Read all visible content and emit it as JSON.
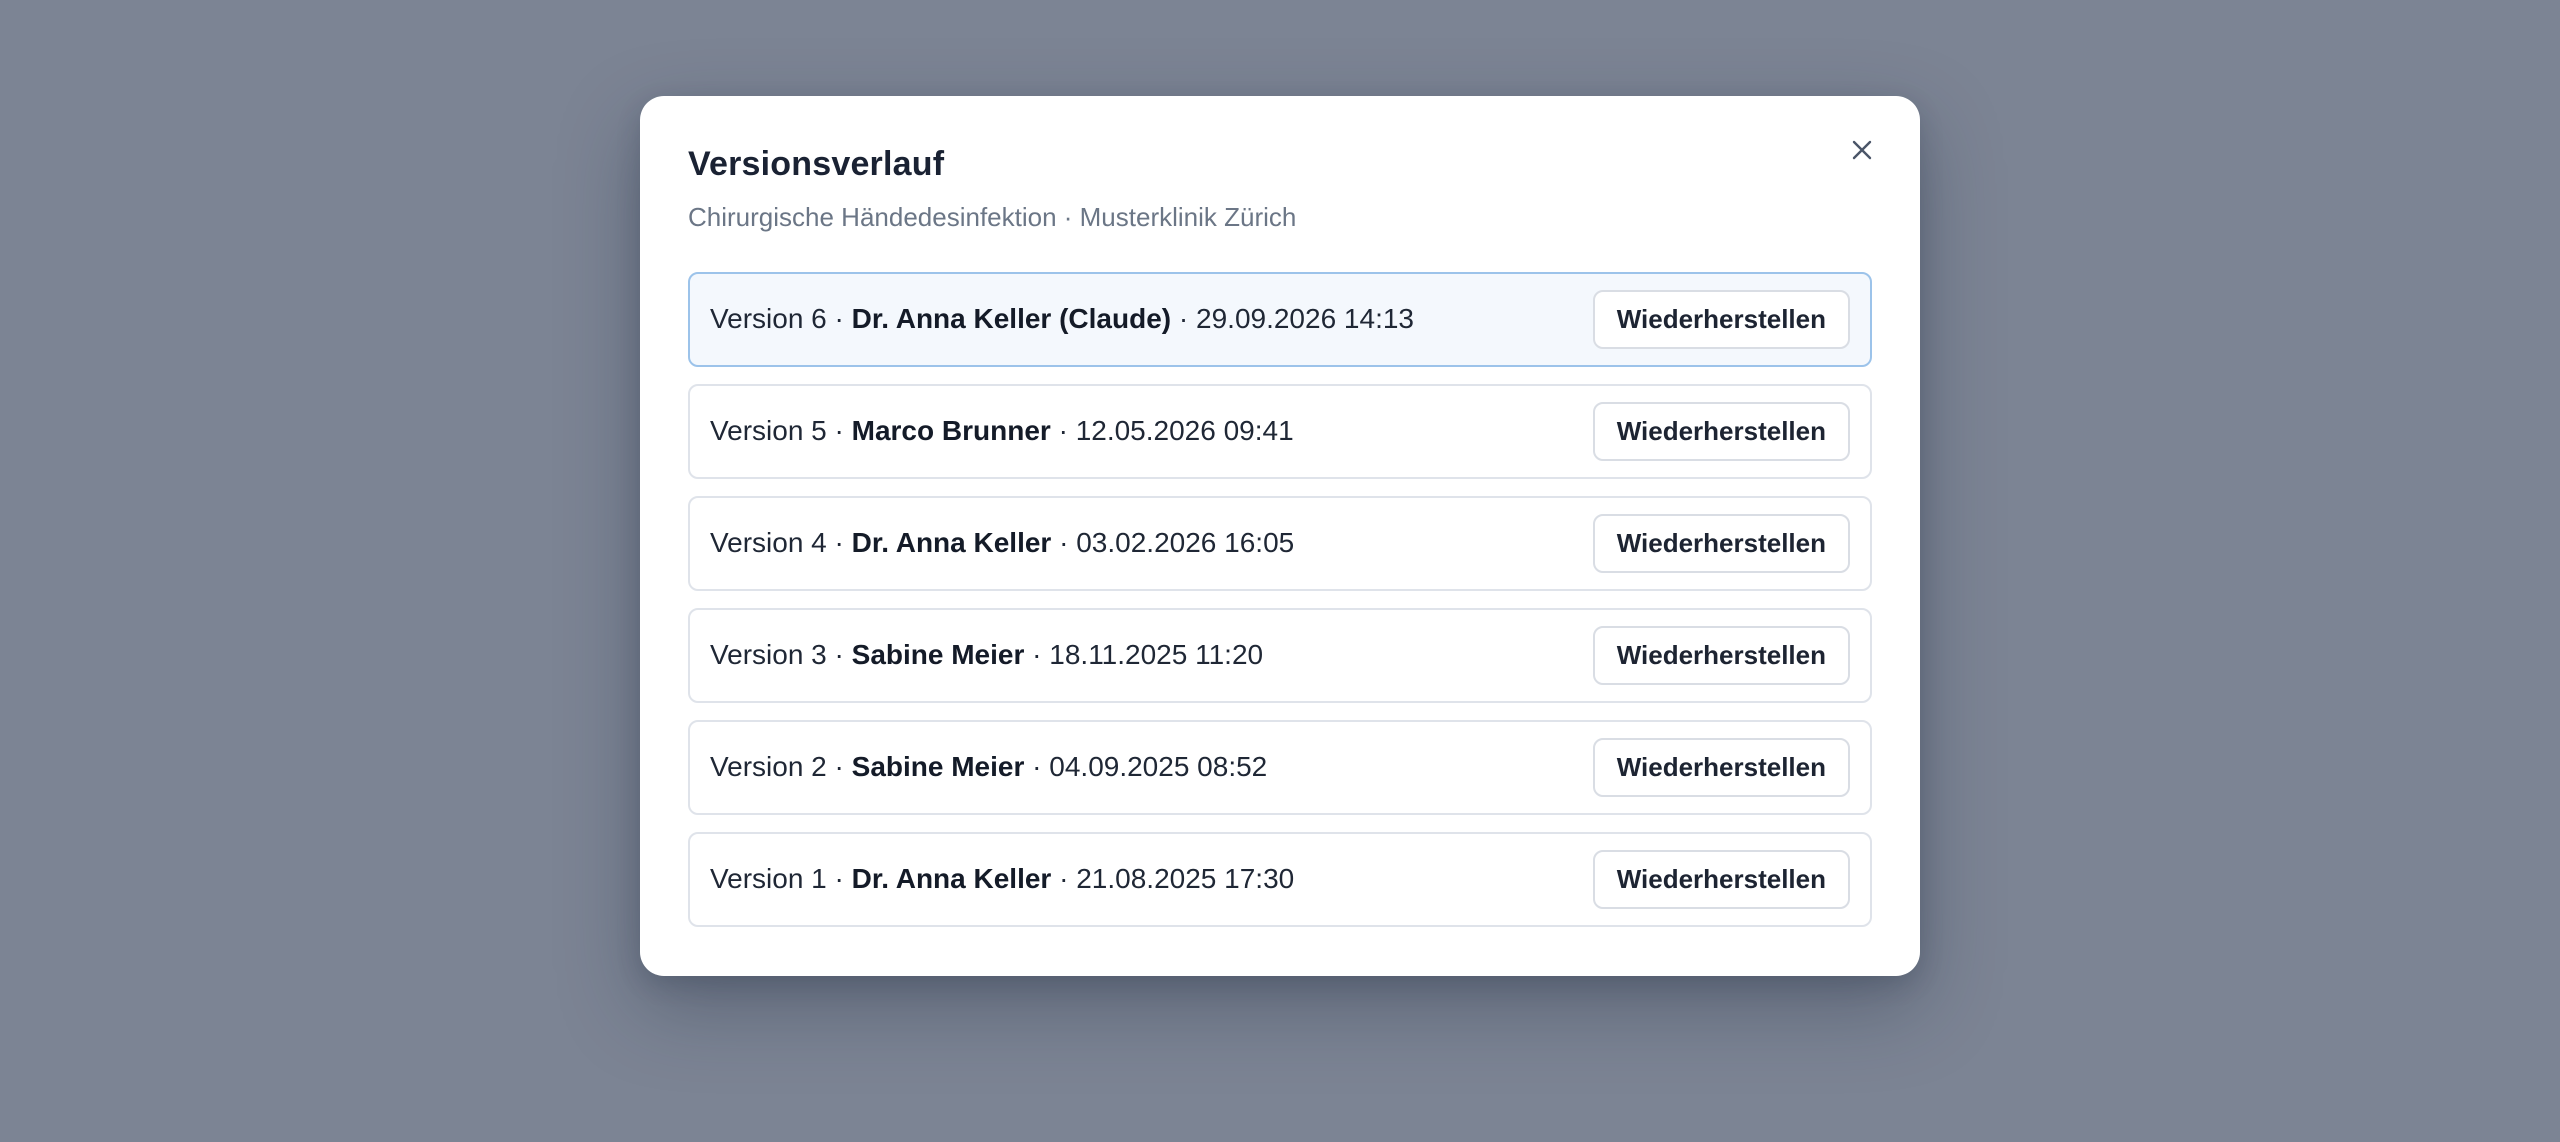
{
  "modal": {
    "title": "Versionsverlauf",
    "subtitle": "Chirurgische Händedesinfektion · Musterklinik Zürich",
    "close_icon": "close-icon"
  },
  "versions": [
    {
      "label": "Version 6",
      "sep1": " · ",
      "author": "Dr. Anna Keller (Claude)",
      "sep2": " · ",
      "date": "29.09.2026 14:13",
      "button": "Wiederherstellen",
      "active": true
    },
    {
      "label": "Version 5",
      "sep1": " · ",
      "author": "Marco Brunner",
      "sep2": " · ",
      "date": "12.05.2026 09:41",
      "button": "Wiederherstellen",
      "active": false
    },
    {
      "label": "Version 4",
      "sep1": " · ",
      "author": "Dr. Anna Keller",
      "sep2": " · ",
      "date": "03.02.2026 16:05",
      "button": "Wiederherstellen",
      "active": false
    },
    {
      "label": "Version 3",
      "sep1": " · ",
      "author": "Sabine Meier",
      "sep2": " · ",
      "date": "18.11.2025 11:20",
      "button": "Wiederherstellen",
      "active": false
    },
    {
      "label": "Version 2",
      "sep1": " · ",
      "author": "Sabine Meier",
      "sep2": " · ",
      "date": "04.09.2025 08:52",
      "button": "Wiederherstellen",
      "active": false
    },
    {
      "label": "Version 1",
      "sep1": " · ",
      "author": "Dr. Anna Keller",
      "sep2": " · ",
      "date": "21.08.2025 17:30",
      "button": "Wiederherstellen",
      "active": false
    }
  ],
  "colors": {
    "backdrop": "#7c8494",
    "active_border": "#9cc3ea",
    "active_bg": "#f4f8fd"
  }
}
